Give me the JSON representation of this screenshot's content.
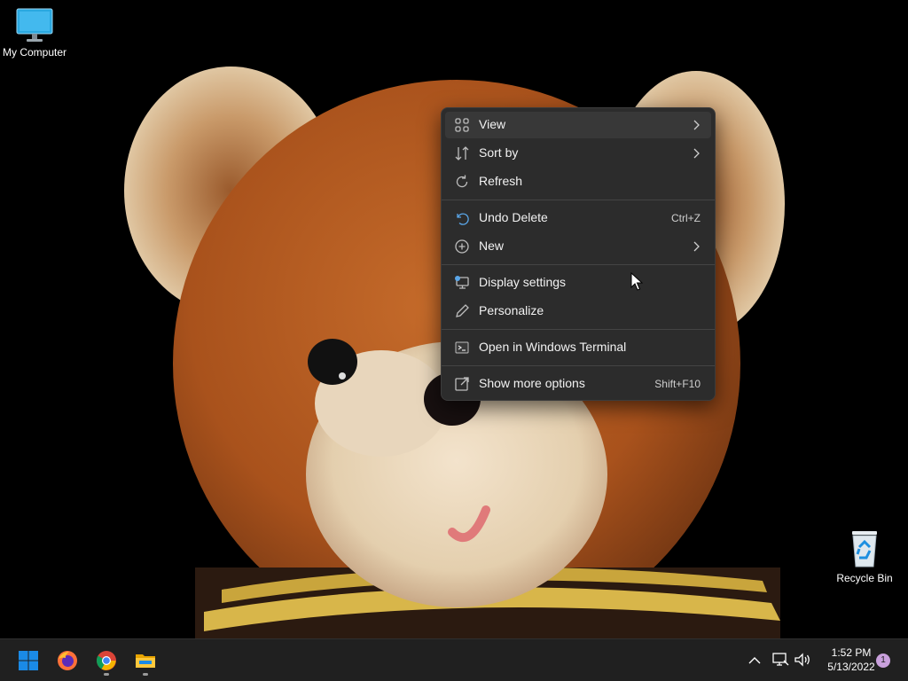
{
  "desktop_icons": {
    "my_computer": {
      "label": "My Computer",
      "icon": "monitor-icon"
    },
    "recycle_bin": {
      "label": "Recycle Bin",
      "icon": "recycle-bin-icon"
    }
  },
  "context_menu": {
    "items": [
      {
        "label": "View",
        "icon": "grid-icon",
        "submenu": true
      },
      {
        "label": "Sort by",
        "icon": "sort-icon",
        "submenu": true
      },
      {
        "label": "Refresh",
        "icon": "refresh-icon"
      },
      {
        "label": "Undo Delete",
        "icon": "undo-icon",
        "shortcut": "Ctrl+Z"
      },
      {
        "label": "New",
        "icon": "plus-circle-icon",
        "submenu": true
      },
      {
        "label": "Display settings",
        "icon": "display-icon"
      },
      {
        "label": "Personalize",
        "icon": "pencil-icon"
      },
      {
        "label": "Open in Windows Terminal",
        "icon": "terminal-icon"
      },
      {
        "label": "Show more options",
        "icon": "expand-icon",
        "shortcut": "Shift+F10"
      }
    ]
  },
  "taskbar": {
    "apps": [
      {
        "name": "start-button",
        "icon": "windows-logo-icon"
      },
      {
        "name": "firefox",
        "icon": "firefox-icon"
      },
      {
        "name": "chrome",
        "icon": "chrome-icon",
        "running": true
      },
      {
        "name": "file-explorer",
        "icon": "folder-icon",
        "running": true
      }
    ],
    "tray_icons": [
      "chevron-up-icon",
      "network-icon",
      "volume-icon"
    ],
    "time": "1:52 PM",
    "date": "5/13/2022",
    "notification_count": "1"
  },
  "colors": {
    "menu_bg": "#2c2c2c",
    "taskbar_bg": "#202020",
    "accent": "#0078d4"
  }
}
